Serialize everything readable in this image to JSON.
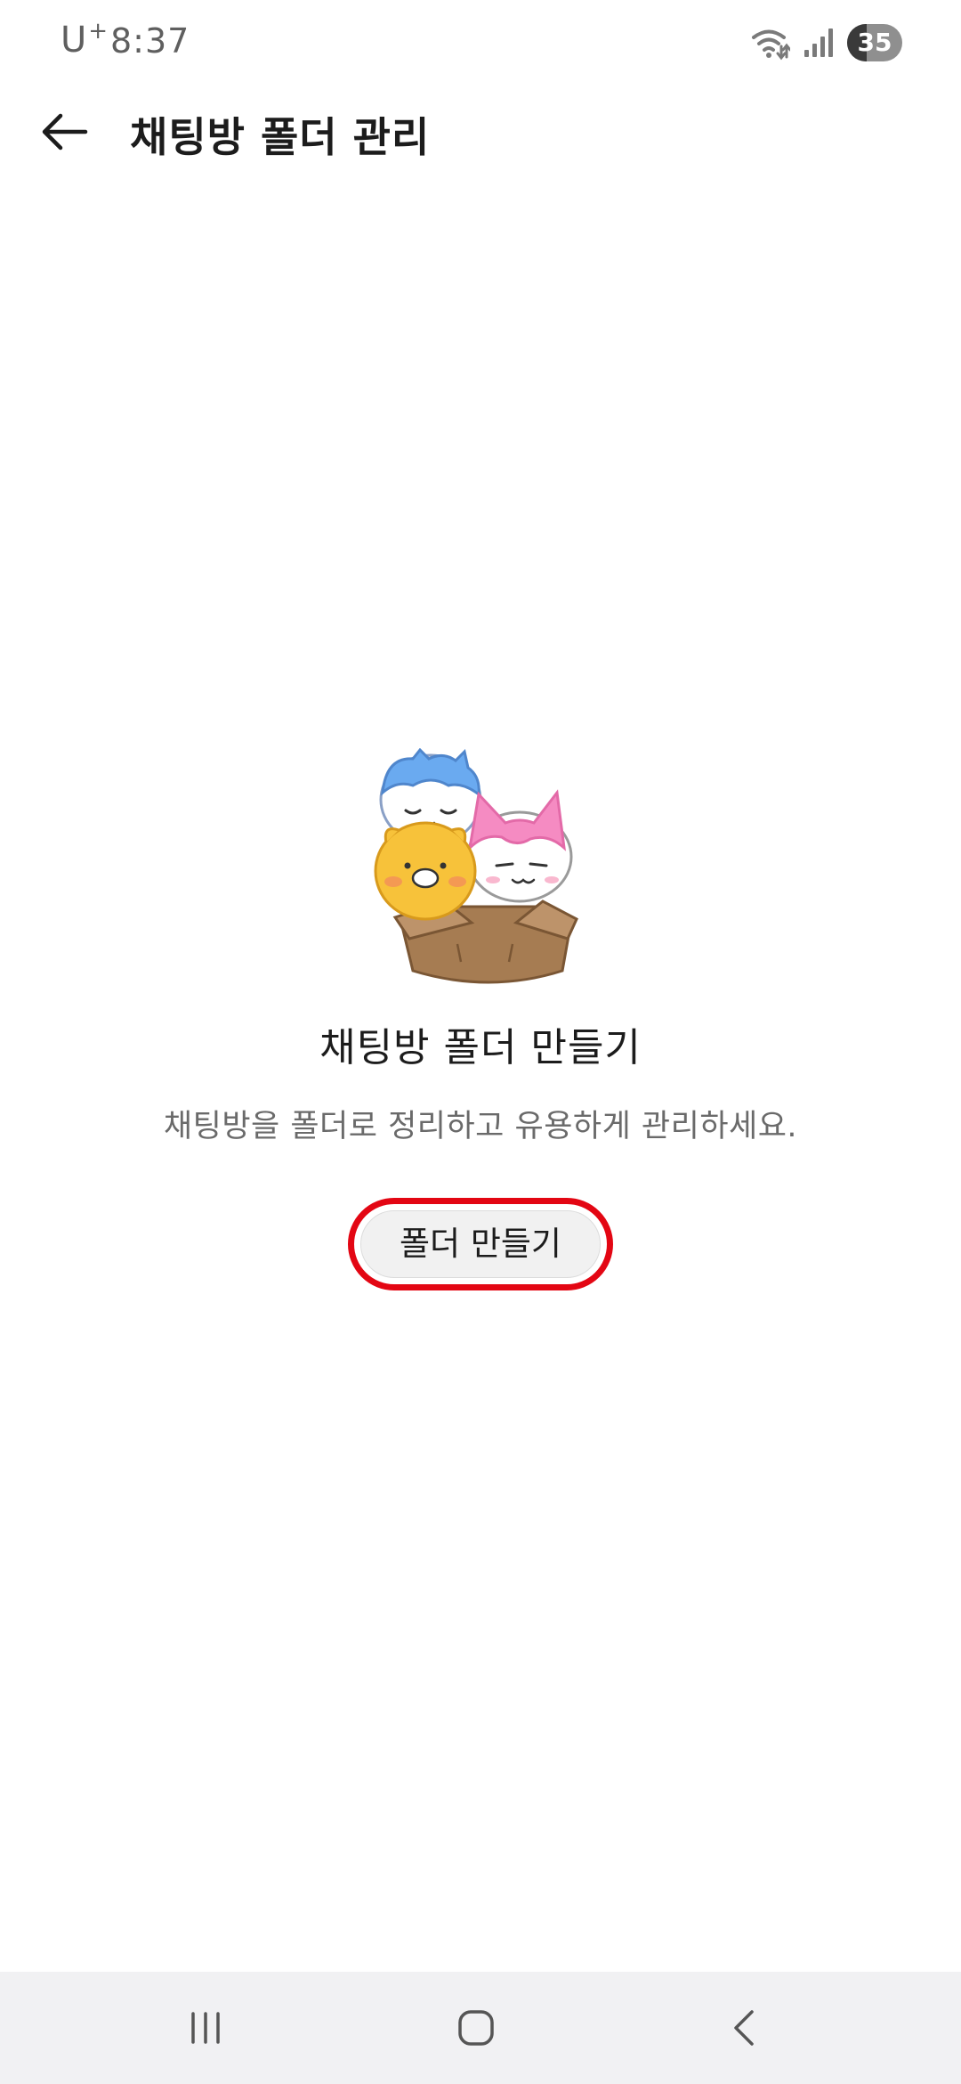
{
  "status_bar": {
    "carrier": "U",
    "carrier_plus": "+",
    "time": "8:37",
    "battery_level": "35",
    "battery_fraction": 0.35,
    "icons": [
      "wifi-icon",
      "signal-icon",
      "battery-icon"
    ]
  },
  "app_bar": {
    "title": "채팅방 폴더 관리",
    "back_icon": "arrow-left-icon"
  },
  "empty_state": {
    "illustration": "characters-in-box-illustration",
    "title": "채팅방 폴더 만들기",
    "description": "채팅방을 폴더로 정리하고 유용하게 관리하세요.",
    "button_label": "폴더 만들기",
    "highlight_color": "#e30613"
  },
  "nav_bar": {
    "items": [
      "recents-icon",
      "home-icon",
      "back-icon"
    ]
  }
}
